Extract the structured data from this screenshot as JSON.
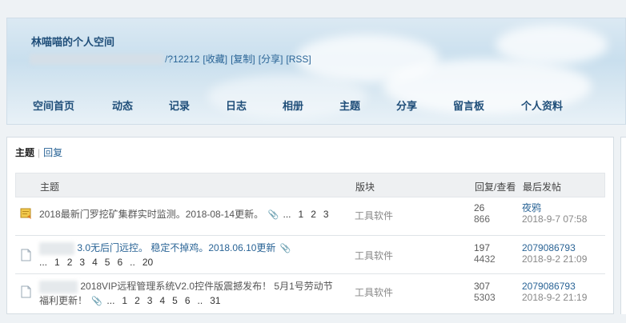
{
  "header": {
    "title": "林喵喵的个人空间",
    "url_suffix": "/?12212",
    "links": [
      "[收藏]",
      "[复制]",
      "[分享]",
      "[RSS]"
    ]
  },
  "nav": [
    "空间首页",
    "动态",
    "记录",
    "日志",
    "相册",
    "主题",
    "分享",
    "留言板",
    "个人资料"
  ],
  "tabs": {
    "active": "主题",
    "other": "回复"
  },
  "table": {
    "headers": {
      "topic": "主题",
      "forum": "版块",
      "replies_views": "回复/查看",
      "last_post": "最后发帖"
    },
    "rows": [
      {
        "icon": "hot-thread-icon",
        "title": "2018最新门罗挖矿集群实时监测。2018-08-14更新。",
        "pages": [
          "...",
          "1",
          "2",
          "3"
        ],
        "forum": "工具软件",
        "replies": "26",
        "views": "866",
        "last_user": "夜鸦",
        "last_time": "2018-9-7 07:58"
      },
      {
        "icon": "document-icon",
        "title": "3.0无后门远控。 稳定不掉鸡。2018.06.10更新",
        "pages": [
          "...",
          "1",
          "2",
          "3",
          "4",
          "5",
          "6",
          "..",
          "20"
        ],
        "forum": "工具软件",
        "replies": "197",
        "views": "4432",
        "last_user": "2079086793",
        "last_time": "2018-9-2 21:09"
      },
      {
        "icon": "document-icon",
        "title_line1": "2018VIP远程管理系统V2.0控件版震撼发布！ 5月1号劳动节",
        "title_line2": "福利更新！",
        "pages": [
          "...",
          "1",
          "2",
          "3",
          "4",
          "5",
          "6",
          "..",
          "31"
        ],
        "forum": "工具软件",
        "replies": "307",
        "views": "5303",
        "last_user": "2079086793",
        "last_time": "2018-9-2 21:19"
      }
    ]
  }
}
